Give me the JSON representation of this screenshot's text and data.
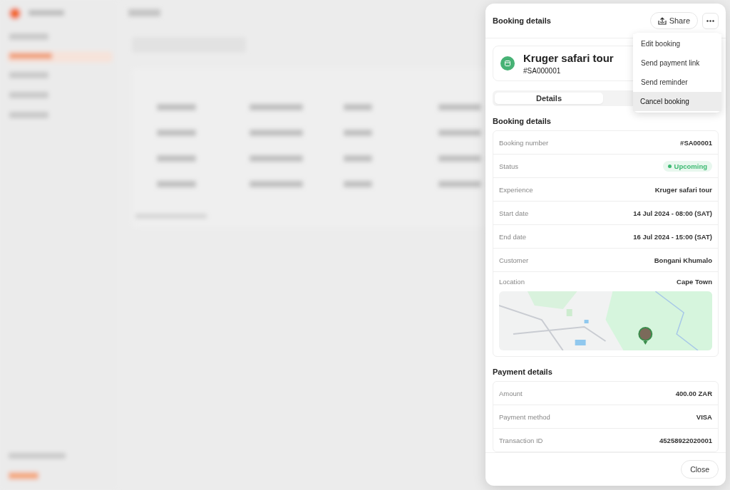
{
  "panel": {
    "title": "Booking details",
    "share_button": "Share"
  },
  "menu": {
    "open": true,
    "items": [
      {
        "label": "Edit booking",
        "selected": false
      },
      {
        "label": "Send payment link",
        "selected": false
      },
      {
        "label": "Send reminder",
        "selected": false
      },
      {
        "label": "Cancel booking",
        "selected": true
      }
    ]
  },
  "experience_card": {
    "title": "Kruger safari tour",
    "number": "#SA000001"
  },
  "tabs": [
    {
      "label": "Details",
      "selected": true
    }
  ],
  "booking_section": {
    "title": "Booking details",
    "rows": [
      {
        "kind": "text",
        "label": "Booking number",
        "value": "#SA00001"
      },
      {
        "kind": "status",
        "label": "Status",
        "value": "Upcoming",
        "color": "#3dba72"
      },
      {
        "kind": "text",
        "label": "Experience",
        "value": "Kruger safari tour"
      },
      {
        "kind": "text",
        "label": "Start date",
        "value": "14 Jul 2024 - 08:00 (SAT)"
      },
      {
        "kind": "text",
        "label": "End date",
        "value": "16 Jul 2024 - 15:00 (SAT)"
      },
      {
        "kind": "text",
        "label": "Customer",
        "value": "Bongani Khumalo"
      },
      {
        "kind": "map",
        "label": "Location",
        "value": "Cape Town"
      }
    ]
  },
  "payment_section": {
    "title": "Payment details",
    "rows": [
      {
        "kind": "text",
        "label": "Amount",
        "value": "400.00 ZAR"
      },
      {
        "kind": "text",
        "label": "Payment method",
        "value": "VISA"
      },
      {
        "kind": "text",
        "label": "Transaction ID",
        "value": "45258922020001"
      }
    ]
  },
  "footer": {
    "close_button": "Close"
  }
}
